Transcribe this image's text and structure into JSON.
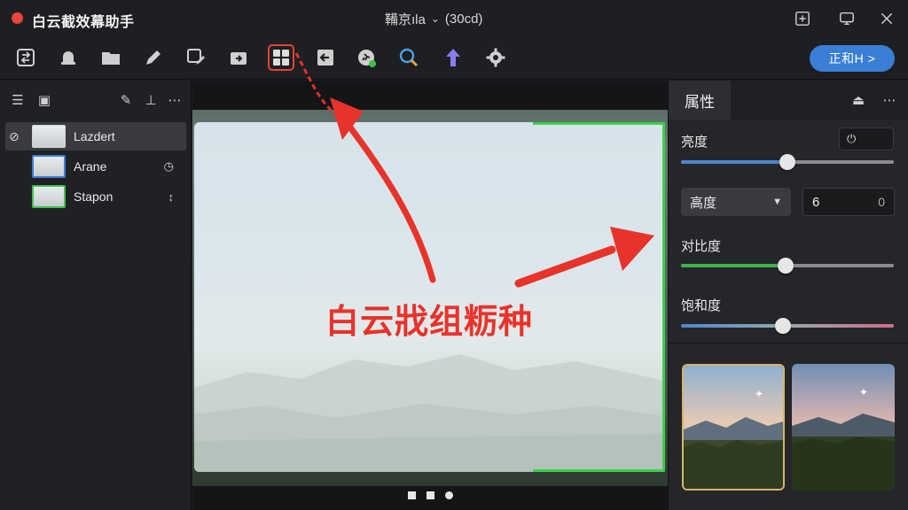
{
  "app": {
    "title": "白云截效幕助手",
    "doc_title": "鞴京ıla",
    "doc_meta": "(30cd)",
    "accent": "#3a7fd5",
    "active_tool_color": "#e0452f"
  },
  "window_controls": [
    {
      "name": "pin-icon",
      "glyph": "⊞"
    },
    {
      "name": "screen-icon",
      "glyph": "▭"
    },
    {
      "name": "close-icon",
      "glyph": "✕"
    }
  ],
  "toolbar": {
    "primary_button": "正和H >",
    "tools": [
      {
        "name": "swap-icon"
      },
      {
        "name": "bell-icon"
      },
      {
        "name": "folder-icon"
      },
      {
        "name": "pen-icon"
      },
      {
        "name": "selection-pen-icon"
      },
      {
        "name": "export-icon"
      },
      {
        "name": "grid-icon"
      },
      {
        "name": "back-arrow-icon"
      },
      {
        "name": "runner-icon"
      },
      {
        "name": "magnify-icon"
      },
      {
        "name": "upload-arrow-icon"
      },
      {
        "name": "gear-icon"
      }
    ]
  },
  "layers_panel": {
    "header_icons": [
      "list-icon",
      "image-icon",
      "edit-icon",
      "anchor-icon",
      "more-icon"
    ],
    "layers": [
      {
        "name": "Lazdert",
        "side": ""
      },
      {
        "name": "Arane",
        "side": "◷"
      },
      {
        "name": "Stapon",
        "side": "↕"
      }
    ]
  },
  "canvas": {
    "annotation": "白云戕组粝种",
    "pager": [
      "square",
      "square",
      "round"
    ]
  },
  "properties": {
    "tab": "属性",
    "brightness": {
      "label": "亮度",
      "value": 0.5,
      "box": "⏻"
    },
    "select": {
      "value": "高度"
    },
    "number_input": {
      "value": "6",
      "end": "0"
    },
    "contrast": {
      "label": "对比度",
      "value": 0.49
    },
    "saturation": {
      "label": "饱和度",
      "value": 0.48
    }
  }
}
